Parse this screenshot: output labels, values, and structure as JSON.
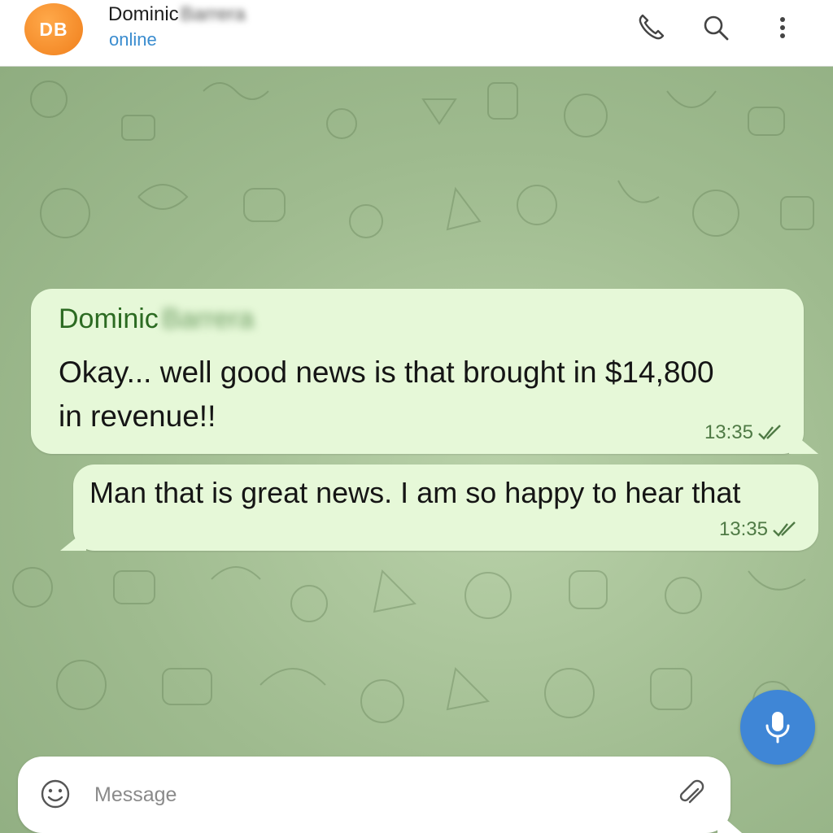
{
  "header": {
    "avatar_initials": "DB",
    "contact_first_name": "Dominic",
    "contact_last_name": "Barrera",
    "status": "online",
    "icons": [
      "phone-icon",
      "search-icon",
      "more-vertical-icon"
    ]
  },
  "messages": [
    {
      "direction": "incoming",
      "sender_first": "Dominic",
      "sender_last": "Barrera",
      "text": "Okay... well good news is that brought in $14,800 in revenue!!",
      "time": "13:35",
      "status_icon": "double-check-icon"
    },
    {
      "direction": "outgoing",
      "text": "Man that is great news. I am so happy to hear that",
      "time": "13:35",
      "status_icon": "double-check-icon"
    }
  ],
  "composer": {
    "placeholder": "Message",
    "value": "",
    "icons": [
      "emoji-icon",
      "attach-icon",
      "mic-icon"
    ]
  },
  "colors": {
    "avatar": "#f28a24",
    "status": "#3a8ccf",
    "bubble": "#e6f8d8",
    "sender_name": "#2c6b22",
    "mic_button": "#3f86d6"
  }
}
